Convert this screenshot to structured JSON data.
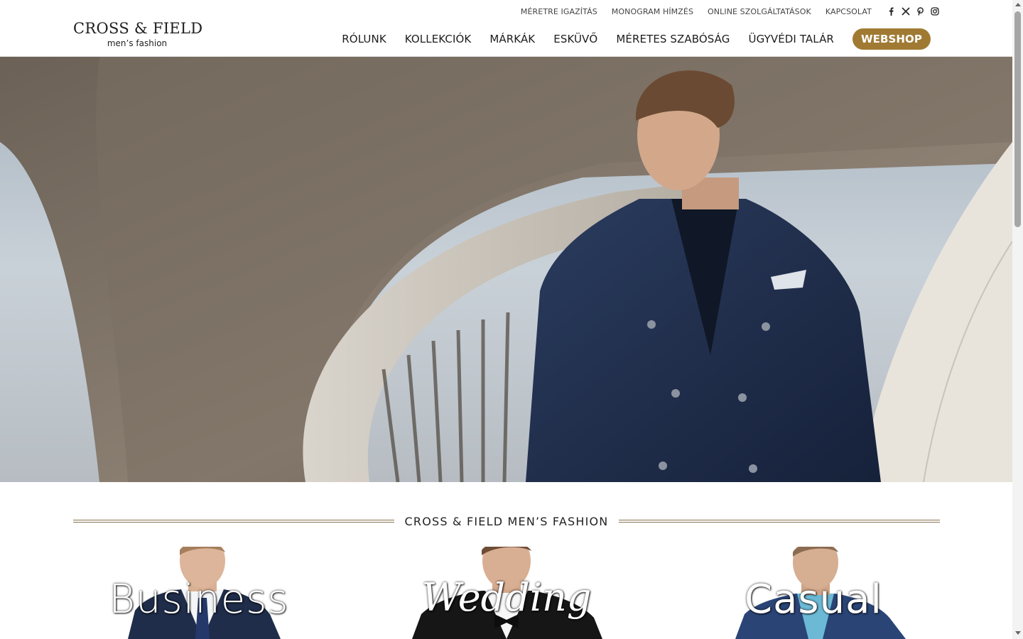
{
  "brand": {
    "name": "CROSS & FIELD",
    "tagline": "men’s fashion"
  },
  "top_links": [
    "MÉRETRE IGAZÍTÁS",
    "MONOGRAM HÍMZÉS",
    "ONLINE SZOLGÁLTATÁSOK",
    "KAPCSOLAT"
  ],
  "social_icons": [
    "facebook-icon",
    "x-icon",
    "pinterest-icon",
    "instagram-icon"
  ],
  "main_nav": [
    "RÓLUNK",
    "KOLLEKCIÓK",
    "MÁRKÁK",
    "ESKÜVŐ",
    "MÉRETES SZABÓSÁG",
    "ÜGYVÉDI TALÁR"
  ],
  "webshop_label": "WEBSHOP",
  "section_title": "CROSS & FIELD MEN’S FASHION",
  "categories": [
    "Business",
    "Wedding",
    "Casual"
  ],
  "colors": {
    "accent": "#a07a33",
    "rule": "#8a7250",
    "suit": "#1f2d4a"
  }
}
